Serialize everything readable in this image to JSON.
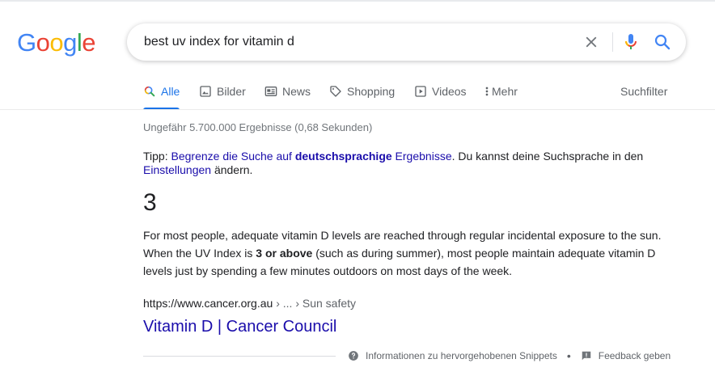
{
  "logo": {
    "letters": [
      "G",
      "o",
      "o",
      "g",
      "l",
      "e"
    ],
    "colors": [
      "#4285f4",
      "#ea4335",
      "#fbbc05",
      "#4285f4",
      "#34a853",
      "#ea4335"
    ]
  },
  "search": {
    "query": "best uv index for vitamin d",
    "clear_icon": "close-icon",
    "mic_icon": "microphone-icon",
    "search_icon": "search-icon"
  },
  "tabs": [
    {
      "label": "Alle",
      "icon": "search-icon",
      "active": true
    },
    {
      "label": "Bilder",
      "icon": "image-icon",
      "active": false
    },
    {
      "label": "News",
      "icon": "news-icon",
      "active": false
    },
    {
      "label": "Shopping",
      "icon": "tag-icon",
      "active": false
    },
    {
      "label": "Videos",
      "icon": "play-icon",
      "active": false
    },
    {
      "label": "Mehr",
      "icon": "more-vert-icon",
      "active": false
    }
  ],
  "tools_label": "Suchfilter",
  "stats": "Ungefähr 5.700.000 Ergebnisse (0,68 Sekunden)",
  "tip": {
    "prefix": "Tipp: ",
    "link_part1": "Begrenze die Suche auf ",
    "link_bold": "deutschsprachige",
    "link_part2": " Ergebnisse",
    "middle": ". Du kannst deine Suchsprache in den ",
    "settings_link": "Einstellungen",
    "suffix": " ändern."
  },
  "featured": {
    "answer": "3",
    "text_1": "For most people, adequate vitamin D levels are reached through regular incidental exposure to the sun. When the UV Index is ",
    "text_bold": "3 or above",
    "text_2": " (such as during summer), most people maintain adequate vitamin D levels just by spending a few minutes outdoors on most days of the week.",
    "url": "https://www.cancer.org.au",
    "breadcrumb": " › ... › Sun safety",
    "title": "Vitamin D | Cancer Council"
  },
  "footer": {
    "info_label": "Informationen zu hervorgehobenen Snippets",
    "info_icon": "help-circle-icon",
    "separator": "•",
    "feedback_label": "Feedback geben",
    "feedback_icon": "feedback-icon"
  },
  "colors": {
    "accent": "#1a73e8",
    "link": "#1a0dab",
    "muted": "#5f6368"
  }
}
